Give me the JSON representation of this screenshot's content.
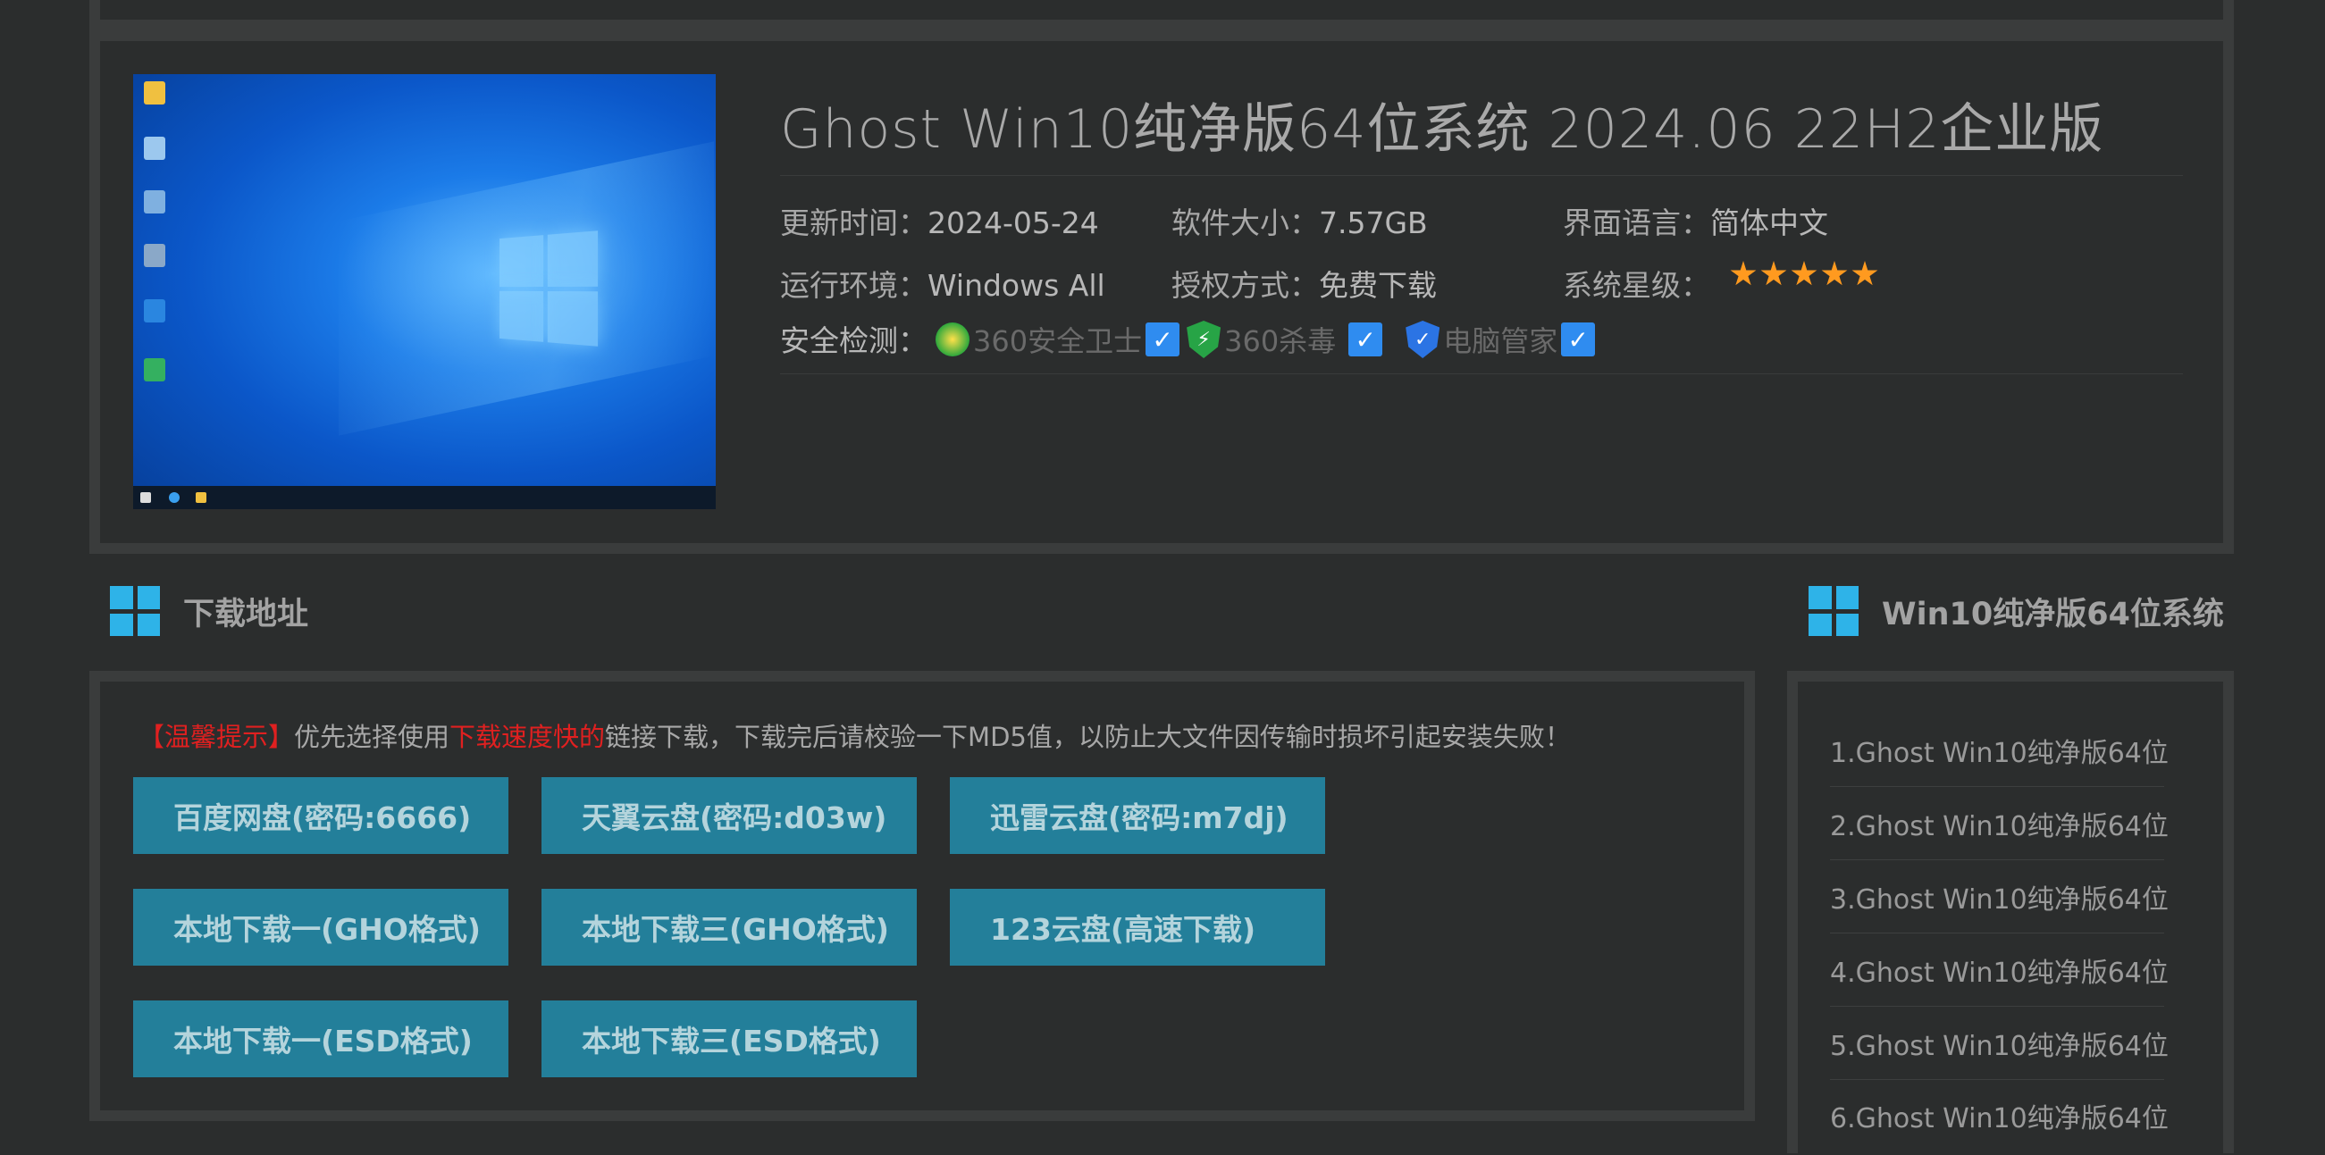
{
  "product": {
    "title": "Ghost Win10纯净版64位系统 2024.06 22H2企业版",
    "meta": [
      {
        "key": "更新时间：",
        "value": "2024-05-24"
      },
      {
        "key": "软件大小：",
        "value": "7.57GB"
      },
      {
        "key": "界面语言：",
        "value": "简体中文"
      },
      {
        "key": "运行环境：",
        "value": "Windows All"
      },
      {
        "key": "授权方式：",
        "value": "免费下载"
      },
      {
        "key": "系统星级：",
        "value": ""
      }
    ],
    "rating": 5,
    "security_label": "安全检测：",
    "security": [
      {
        "name": "360安全卫士",
        "icon": "360-safe-icon"
      },
      {
        "name": "360杀毒",
        "icon": "360-antivirus-icon"
      },
      {
        "name": "电脑管家",
        "icon": "pc-manager-icon"
      }
    ],
    "check_glyph": "✓"
  },
  "download": {
    "heading": "下载地址",
    "tip": {
      "prefix": "【温馨提示】",
      "part1": "优先选择使用",
      "highlight": "下载速度快的",
      "part2": "链接下载，下载完后请校验一下MD5值，以防止大文件因传输时损坏引起安装失败！"
    },
    "buttons": [
      "百度网盘(密码:6666)",
      "天翼云盘(密码:d03w)",
      "迅雷云盘(密码:m7dj)",
      "本地下载一(GHO格式)",
      "本地下载三(GHO格式)",
      "123云盘(高速下载)",
      "本地下载一(ESD格式)",
      "本地下载三(ESD格式)"
    ]
  },
  "sidebar": {
    "heading": "Win10纯净版64位系统",
    "items": [
      "1.Ghost Win10纯净版64位",
      "2.Ghost Win10纯净版64位",
      "3.Ghost Win10纯净版64位",
      "4.Ghost Win10纯净版64位",
      "5.Ghost Win10纯净版64位",
      "6.Ghost Win10纯净版64位"
    ]
  },
  "colors": {
    "accent": "#2eb3e8",
    "button": "#237f9a",
    "warning": "#e02020",
    "star": "#ff9a1f"
  }
}
